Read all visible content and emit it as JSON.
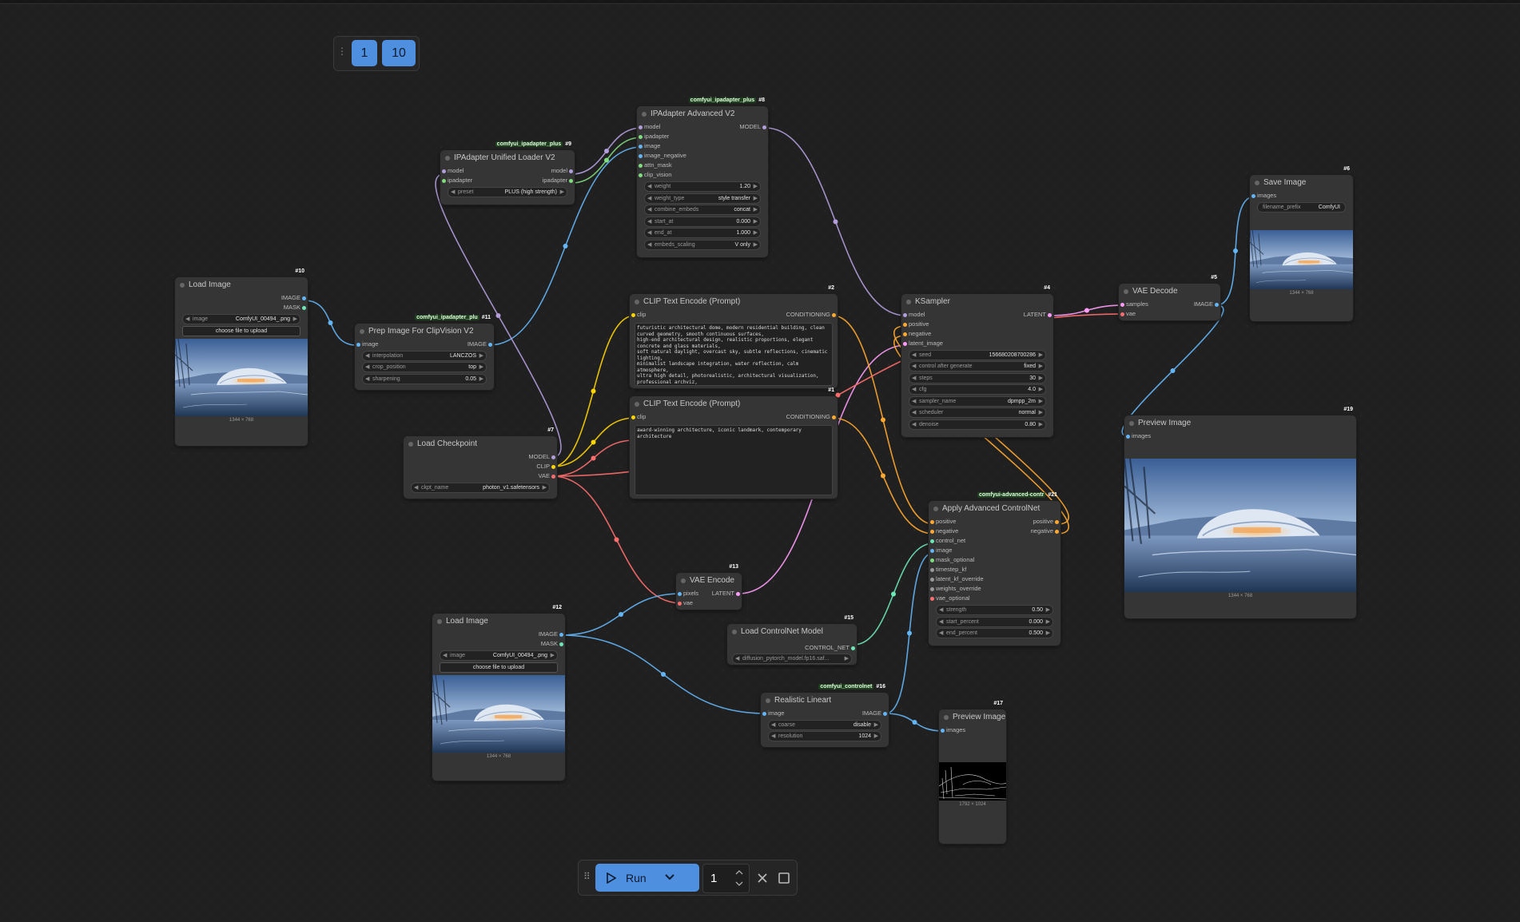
{
  "pager": {
    "page_a": "1",
    "page_b": "10"
  },
  "runbar": {
    "run_label": "Run",
    "batch_count": "1"
  },
  "nodes": {
    "load_image_10": {
      "title": "Load Image",
      "id": "#10",
      "out1": "IMAGE",
      "out2": "MASK",
      "w_image_label": "image",
      "w_image_value": "ComfyUI_00494_.png",
      "upload": "choose file to upload",
      "caption": "1344 × 768"
    },
    "ipa_loader_9": {
      "title": "IPAdapter Unified Loader V2",
      "id": "#9",
      "pack": "comfyui_ipadapter_plus",
      "in1": "model",
      "in2": "ipadapter",
      "out1": "model",
      "out2": "ipadapter",
      "w_label": "preset",
      "w_value": "PLUS (high strength)"
    },
    "ipa_adv_8": {
      "title": "IPAdapter Advanced V2",
      "id": "#8",
      "pack": "comfyui_ipadapter_plus",
      "in": [
        "model",
        "ipadapter",
        "image",
        "image_negative",
        "attn_mask",
        "clip_vision"
      ],
      "out1": "MODEL",
      "widgets": [
        {
          "l": "weight",
          "v": "1.20"
        },
        {
          "l": "weight_type",
          "v": "style transfer"
        },
        {
          "l": "combine_embeds",
          "v": "concat"
        },
        {
          "l": "start_at",
          "v": "0.000"
        },
        {
          "l": "end_at",
          "v": "1.000"
        },
        {
          "l": "embeds_scaling",
          "v": "V only"
        }
      ]
    },
    "prep_11": {
      "title": "Prep Image For ClipVision V2",
      "id": "#11",
      "pack": "comfyui_ipadapter_plu",
      "in1": "image",
      "out1": "IMAGE",
      "widgets": [
        {
          "l": "interpolation",
          "v": "LANCZOS"
        },
        {
          "l": "crop_position",
          "v": "top"
        },
        {
          "l": "sharpening",
          "v": "0.05"
        }
      ]
    },
    "clip_2": {
      "title": "CLIP Text Encode (Prompt)",
      "id": "#2",
      "in1": "clip",
      "out1": "CONDITIONING",
      "text": "futuristic architectural dome, modern residential building, clean curved geometry, smooth continuous surfaces,\nhigh-end architectural design, realistic proportions, elegant concrete and glass materials,\nsoft natural daylight, overcast sky, subtle reflections, cinematic lighting,\nminimalist landscape integration, water reflection, calm atmosphere,\nultra high detail, photorealistic, architectural visualization, professional archviz,\nsharp focus, balanced composition, realistic scale, global illumination"
    },
    "clip_1": {
      "title": "CLIP Text Encode (Prompt)",
      "id": "#1",
      "in1": "clip",
      "out1": "CONDITIONING",
      "text": "award-winning architecture, iconic landmark, contemporary architecture"
    },
    "ckpt_7": {
      "title": "Load Checkpoint",
      "id": "#7",
      "out1": "MODEL",
      "out2": "CLIP",
      "out3": "VAE",
      "w_label": "ckpt_name",
      "w_value": "photon_v1.safetensors"
    },
    "ksampler_4": {
      "title": "KSampler",
      "id": "#4",
      "in": [
        "model",
        "positive",
        "negative",
        "latent_image"
      ],
      "out1": "LATENT",
      "widgets": [
        {
          "l": "seed",
          "v": "156680208700286"
        },
        {
          "l": "control after generate",
          "v": "fixed"
        },
        {
          "l": "steps",
          "v": "30"
        },
        {
          "l": "cfg",
          "v": "4.0"
        },
        {
          "l": "sampler_name",
          "v": "dpmpp_2m"
        },
        {
          "l": "scheduler",
          "v": "normal"
        },
        {
          "l": "denoise",
          "v": "0.80"
        }
      ]
    },
    "vae_decode_5": {
      "title": "VAE Decode",
      "id": "#5",
      "in1": "samples",
      "in2": "vae",
      "out1": "IMAGE"
    },
    "save_6": {
      "title": "Save Image",
      "id": "#6",
      "in1": "images",
      "w_label": "filename_prefix",
      "w_value": "ComfyUI",
      "caption": "1344 × 768"
    },
    "preview_19": {
      "title": "Preview Image",
      "id": "#19",
      "in1": "images",
      "caption": "1344 × 768"
    },
    "acn_21": {
      "title": "Apply Advanced ControlNet",
      "id": "#21",
      "pack": "comfyui-advanced-contr",
      "in": [
        "positive",
        "negative",
        "control_net",
        "image",
        "mask_optional",
        "timestep_kf",
        "latent_kf_override",
        "weights_override",
        "vae_optional"
      ],
      "out1": "positive",
      "out2": "negative",
      "widgets": [
        {
          "l": "strength",
          "v": "0.50"
        },
        {
          "l": "start_percent",
          "v": "0.000"
        },
        {
          "l": "end_percent",
          "v": "0.500"
        }
      ]
    },
    "vae_encode_13": {
      "title": "VAE Encode",
      "id": "#13",
      "in1": "pixels",
      "in2": "vae",
      "out1": "LATENT"
    },
    "load_image_12": {
      "title": "Load Image",
      "id": "#12",
      "out1": "IMAGE",
      "out2": "MASK",
      "w_image_label": "image",
      "w_image_value": "ComfyUI_00494_.png",
      "upload": "choose file to upload",
      "caption": "1344 × 768"
    },
    "cn_loader_15": {
      "title": "Load ControlNet Model",
      "id": "#15",
      "out1": "CONTROL_NET",
      "w_value": "diffusion_pytorch_model.fp16.saf..."
    },
    "lineart_16": {
      "title": "Realistic Lineart",
      "id": "#16",
      "pack": "comfyui_controlnet",
      "in1": "image",
      "out1": "IMAGE",
      "widgets": [
        {
          "l": "coarse",
          "v": "disable"
        },
        {
          "l": "resolution",
          "v": "1024"
        }
      ]
    },
    "preview_17": {
      "title": "Preview Image",
      "id": "#17",
      "in1": "images",
      "caption": "1792 × 1024"
    }
  },
  "colors": {
    "model": "#b39ddb",
    "clip": "#ffd500",
    "vae": "#ff6e6e",
    "image": "#64b5f6",
    "conditioning": "#ffa931",
    "latent": "#ff9cf9",
    "control_net": "#6ee7b7",
    "ipadapter": "#7fdc7f",
    "accent": "#4f8fe0"
  }
}
